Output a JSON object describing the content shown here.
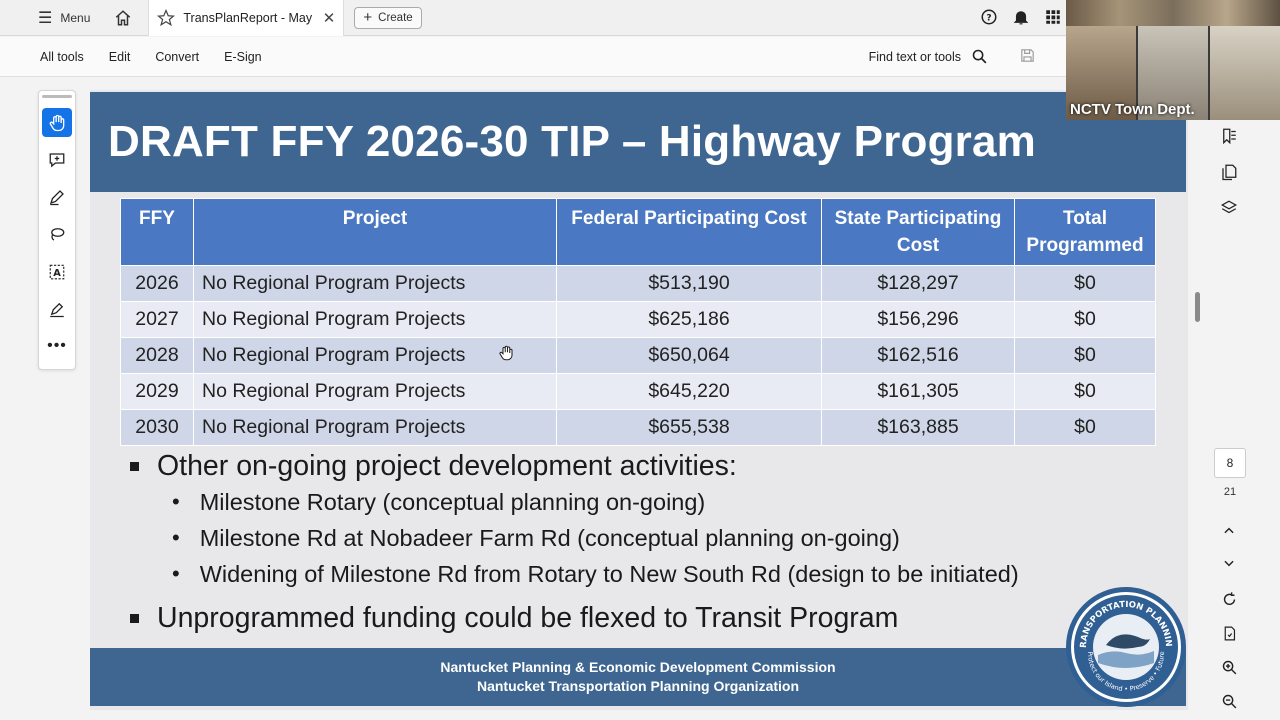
{
  "topbar": {
    "menu_label": "Menu",
    "tab_title": "TransPlanReport - May ...",
    "create_label": "Create"
  },
  "toolbar": {
    "items": [
      "All tools",
      "Edit",
      "Convert",
      "E-Sign"
    ],
    "find_label": "Find text or tools"
  },
  "slide": {
    "title": "DRAFT FFY 2026-30 TIP – Highway Program",
    "table": {
      "headers": [
        "FFY",
        "Project",
        "Federal Participating Cost",
        "State Participating Cost",
        "Total Programmed"
      ],
      "rows": [
        [
          "2026",
          "No Regional Program Projects",
          "$513,190",
          "$128,297",
          "$0"
        ],
        [
          "2027",
          "No Regional Program Projects",
          "$625,186",
          "$156,296",
          "$0"
        ],
        [
          "2028",
          "No Regional Program Projects",
          "$650,064",
          "$162,516",
          "$0"
        ],
        [
          "2029",
          "No Regional Program Projects",
          "$645,220",
          "$161,305",
          "$0"
        ],
        [
          "2030",
          "No Regional Program Projects",
          "$655,538",
          "$163,885",
          "$0"
        ]
      ]
    },
    "bullets": {
      "b1": "Other on-going project development activities:",
      "sub": [
        "Milestone Rotary (conceptual planning on-going)",
        "Milestone Rd at Nobadeer Farm Rd (conceptual planning on-going)",
        "Widening of Milestone Rd from Rotary to New South Rd (design to be initiated)"
      ],
      "b2": "Unprogrammed funding could be flexed to Transit Program"
    },
    "footer": {
      "line1": "Nantucket Planning & Economic Development Commission",
      "line2": "Nantucket Transportation Planning Organization"
    },
    "logo": {
      "top_text": "TRANSPORTATION PLANNING",
      "bottom_text": "Protect our Island • Preserve • Future"
    }
  },
  "pager": {
    "current": "8",
    "total": "21"
  },
  "video": {
    "label": "NCTV Town Dept."
  },
  "colors": {
    "header_blue": "#3e6690",
    "table_head": "#4a78c2",
    "accent": "#1473e6"
  }
}
